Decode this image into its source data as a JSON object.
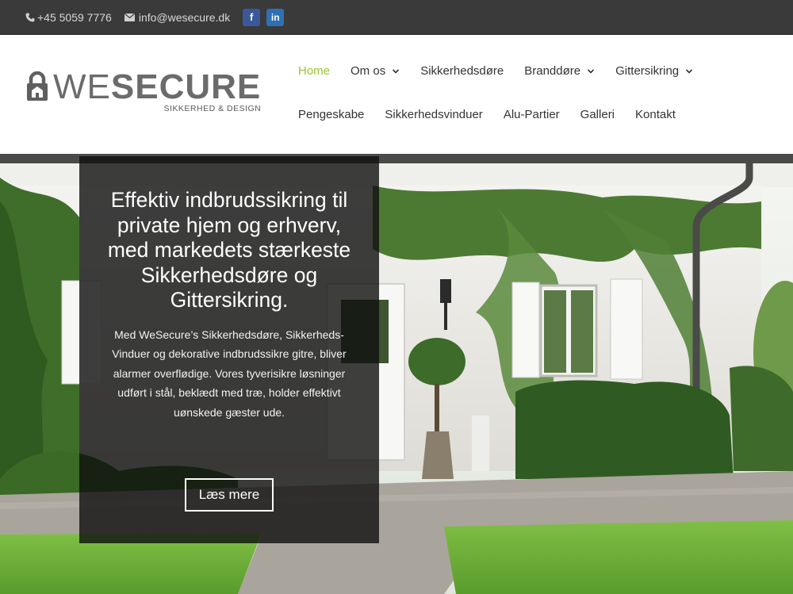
{
  "topbar": {
    "phone": "+45 5059 7776",
    "email": "info@wesecure.dk",
    "icons": [
      "phone-icon",
      "mail-icon",
      "facebook-icon",
      "linkedin-icon"
    ],
    "facebook_glyph": "f",
    "linkedin_glyph": "in"
  },
  "logo": {
    "word1": "WE",
    "word2": "SECURE",
    "tagline": "SIKKERHED & DESIGN"
  },
  "nav": {
    "row1": [
      {
        "label": "Home",
        "active": true,
        "dropdown": false
      },
      {
        "label": "Om os",
        "active": false,
        "dropdown": true
      },
      {
        "label": "Sikkerhedsdøre",
        "active": false,
        "dropdown": false
      },
      {
        "label": "Branddøre",
        "active": false,
        "dropdown": true
      },
      {
        "label": "Gittersikring",
        "active": false,
        "dropdown": true
      }
    ],
    "row2": [
      {
        "label": "Pengeskabe"
      },
      {
        "label": "Sikkerhedsvinduer"
      },
      {
        "label": "Alu-Partier"
      },
      {
        "label": "Galleri"
      },
      {
        "label": "Kontakt"
      }
    ]
  },
  "hero": {
    "headline": "Effektiv indbrudssikring til private hjem og erhverv, med markedets stærkeste Sikkerhedsdøre og Gittersikring.",
    "body": "Med WeSecure’s Sikkerhedsdøre, Sikkerheds-Vinduer og dekorative indbrudssikre gitre, bliver alarmer overflødige. Vores tyverisikre løsninger udført i stål, beklædt med træ, holder effektivt uønskede gæster ude.",
    "button_label": "Læs mere"
  },
  "colors": {
    "topbar": "#3a3a3a",
    "accent": "#9cc233",
    "overlay": "rgba(15,15,15,0.8)"
  }
}
